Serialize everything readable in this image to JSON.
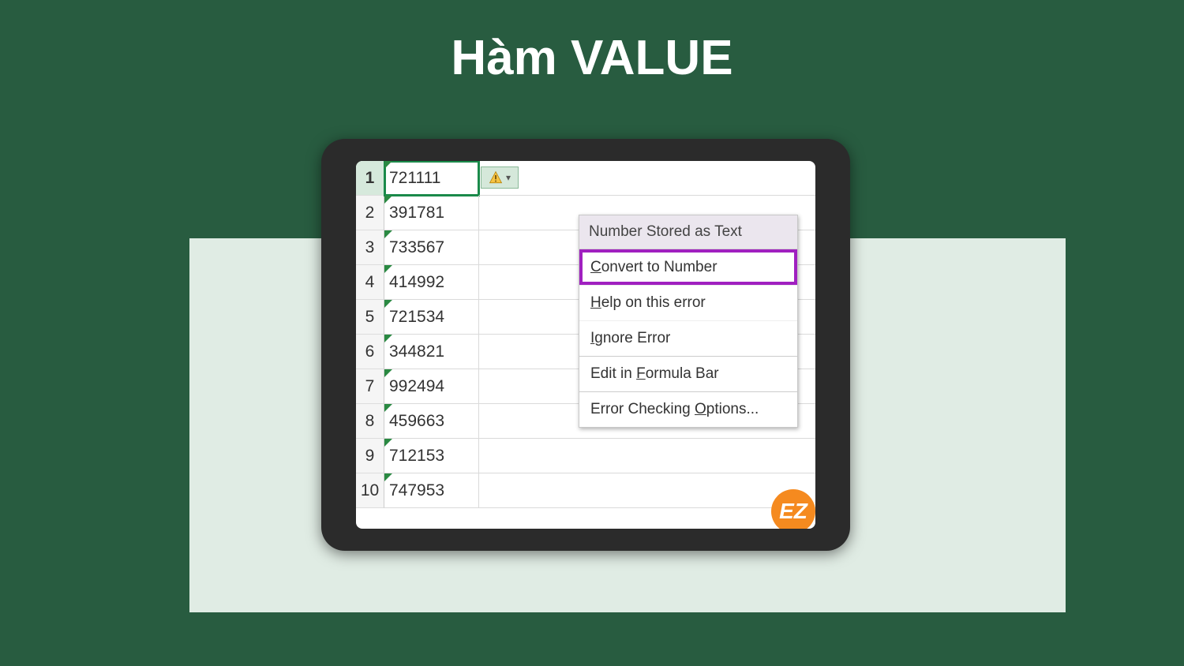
{
  "title": "Hàm VALUE",
  "rows": [
    {
      "n": 1,
      "v": "721111",
      "selected": true
    },
    {
      "n": 2,
      "v": "391781"
    },
    {
      "n": 3,
      "v": "733567"
    },
    {
      "n": 4,
      "v": "414992"
    },
    {
      "n": 5,
      "v": "721534"
    },
    {
      "n": 6,
      "v": "344821"
    },
    {
      "n": 7,
      "v": "992494"
    },
    {
      "n": 8,
      "v": "459663"
    },
    {
      "n": 9,
      "v": "712153"
    },
    {
      "n": 10,
      "v": "747953"
    }
  ],
  "menu": {
    "header": "Number Stored as Text",
    "items": [
      {
        "label_pre": "",
        "accel": "C",
        "label_post": "onvert to Number",
        "highlight": true
      },
      {
        "label_pre": "",
        "accel": "H",
        "label_post": "elp on this error"
      },
      {
        "label_pre": "",
        "accel": "I",
        "label_post": "gnore Error"
      },
      {
        "label_pre": "Edit in ",
        "accel": "F",
        "label_post": "ormula Bar",
        "sep": true
      },
      {
        "label_pre": "Error Checking ",
        "accel": "O",
        "label_post": "ptions...",
        "sep": true
      }
    ]
  },
  "badge": "EZ"
}
